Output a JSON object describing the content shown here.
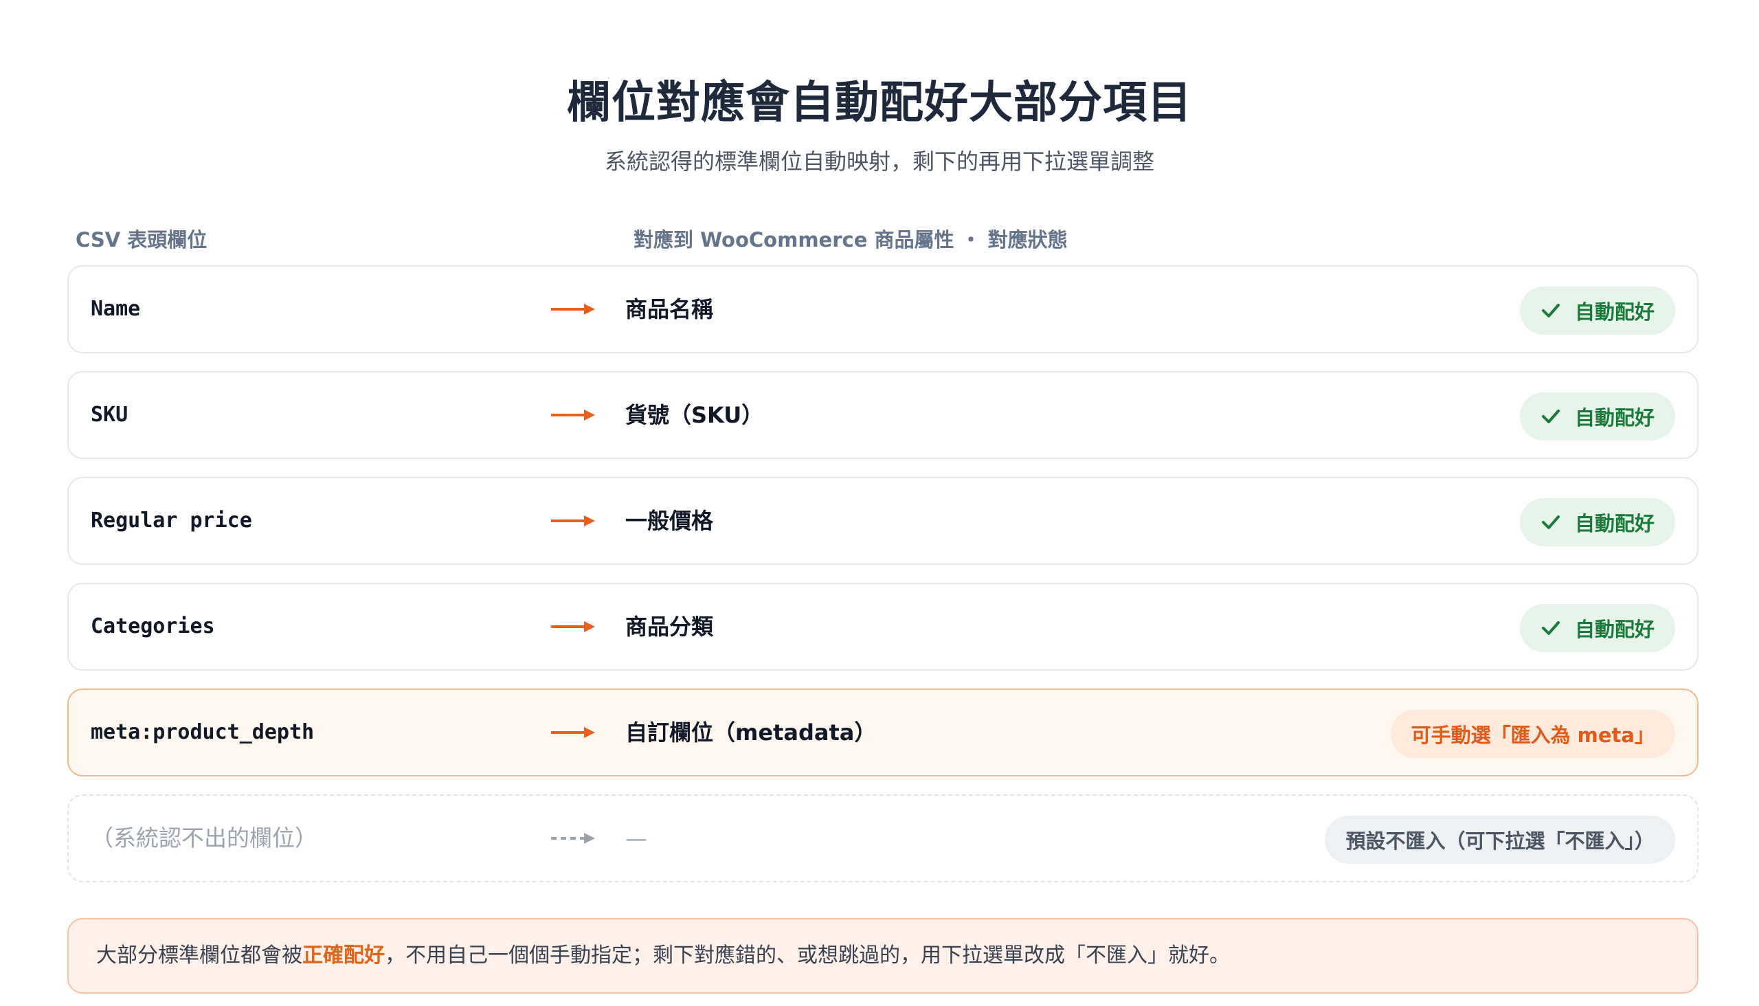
{
  "header": {
    "title": "欄位對應會自動配好大部分項目",
    "subtitle": "系統認得的標準欄位自動映射，剩下的再用下拉選單調整"
  },
  "columns": {
    "csv": "CSV 表頭欄位",
    "target": "對應到 WooCommerce 商品屬性 ・ 對應狀態"
  },
  "colors": {
    "accent": "#e8601c",
    "ok_green": "#1a7a3a",
    "ok_bg": "#e6f4ea",
    "manual_bg": "#ffeadb",
    "muted": "#9ca3af"
  },
  "rows": [
    {
      "csv": "Name",
      "target": "商品名稱",
      "status": "自動配好",
      "status_type": "ok",
      "arrow": "arrow-right-icon"
    },
    {
      "csv": "SKU",
      "target": "貨號（SKU）",
      "status": "自動配好",
      "status_type": "ok",
      "arrow": "arrow-right-icon"
    },
    {
      "csv": "Regular price",
      "target": "一般價格",
      "status": "自動配好",
      "status_type": "ok",
      "arrow": "arrow-right-icon"
    },
    {
      "csv": "Categories",
      "target": "商品分類",
      "status": "自動配好",
      "status_type": "ok",
      "arrow": "arrow-right-icon"
    },
    {
      "csv": "meta:product_depth",
      "target": "自訂欄位（metadata）",
      "status": "可手動選「匯入為 meta」",
      "status_type": "manual",
      "arrow": "arrow-right-icon"
    },
    {
      "csv": "（系統認不出的欄位）",
      "target": "—",
      "status": "預設不匯入（可下拉選「不匯入」）",
      "status_type": "skip",
      "arrow": "dashed-arrow-right-icon"
    }
  ],
  "note": {
    "before": "大部分標準欄位都會被",
    "highlight": "正確配好",
    "after": "，不用自己一個個手動指定；剩下對應錯的、或想跳過的，用下拉選單改成「不匯入」就好。"
  }
}
